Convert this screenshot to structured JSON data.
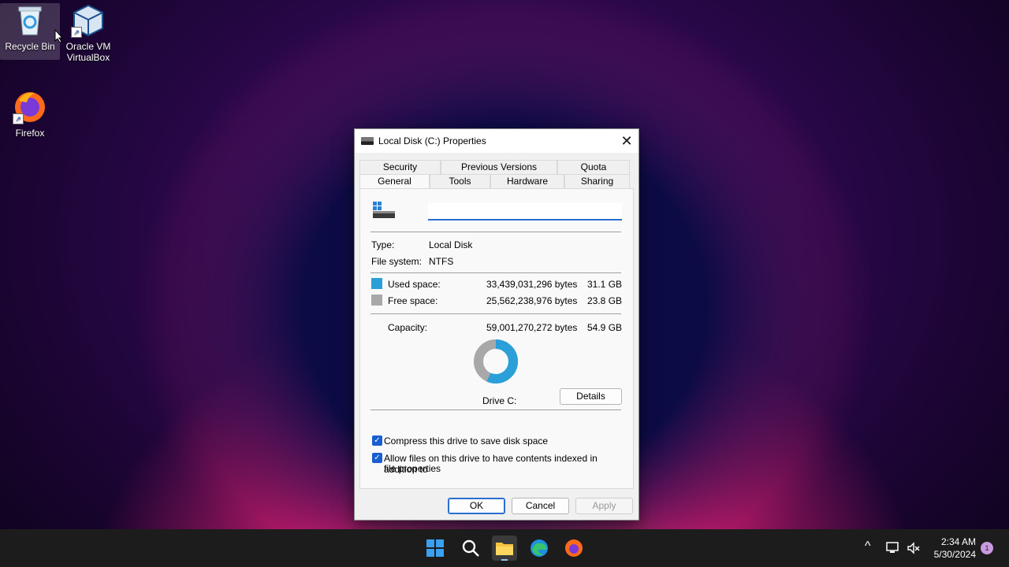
{
  "desktop": {
    "icons": [
      {
        "label": "Recycle Bin"
      },
      {
        "label": "Oracle VM VirtualBox"
      },
      {
        "label": "Firefox"
      }
    ]
  },
  "dialog": {
    "title": "Local Disk (C:) Properties",
    "close_glyph": "✕",
    "tabs_back": [
      "Security",
      "Previous Versions",
      "Quota"
    ],
    "tabs_front": [
      "General",
      "Tools",
      "Hardware",
      "Sharing"
    ],
    "active_tab": "General",
    "drive_name_value": "",
    "type_label": "Type:",
    "type_value": "Local Disk",
    "fs_label": "File system:",
    "fs_value": "NTFS",
    "used_label": "Used space:",
    "used_bytes": "33,439,031,296 bytes",
    "used_gb": "31.1 GB",
    "free_label": "Free space:",
    "free_bytes": "25,562,238,976 bytes",
    "free_gb": "23.8 GB",
    "capacity_label": "Capacity:",
    "capacity_bytes": "59,001,270,272 bytes",
    "capacity_gb": "54.9 GB",
    "used_fraction": 0.567,
    "drive_label": "Drive C:",
    "details_button": "Details",
    "compress_label": "Compress this drive to save disk space",
    "compress_checked": true,
    "index_label_1": "Allow files on this drive to have contents indexed in addition to",
    "index_label_2": "file properties",
    "index_checked": true,
    "ok_button": "OK",
    "cancel_button": "Cancel",
    "apply_button": "Apply",
    "colors": {
      "used": "#2a9fd8",
      "free": "#a8a8a8"
    }
  },
  "taskbar": {
    "time": "2:34 AM",
    "date": "5/30/2024",
    "notification_count": "1",
    "icons": [
      "windows-start-icon",
      "search-icon",
      "file-explorer-icon",
      "edge-icon",
      "firefox-icon"
    ],
    "tray": [
      "chevron-up-icon",
      "network-icon",
      "volume-muted-icon"
    ]
  }
}
